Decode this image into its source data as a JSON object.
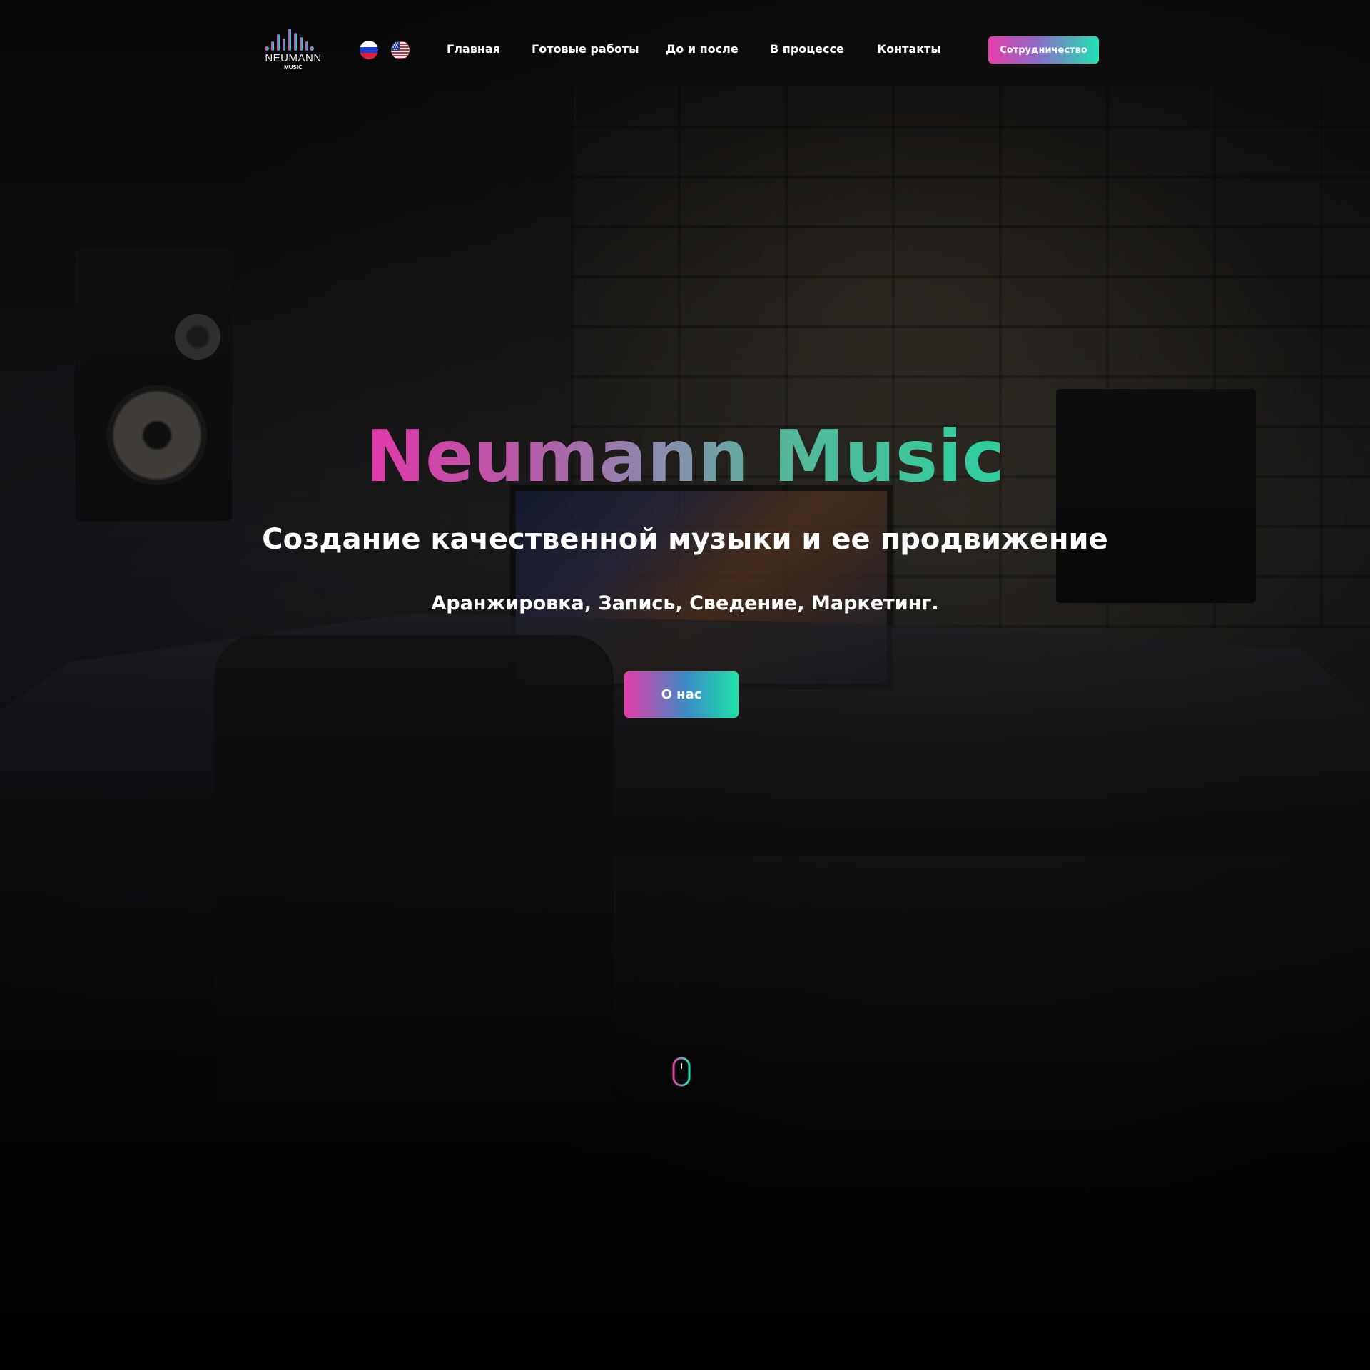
{
  "header": {
    "logo": {
      "name": "NEUMANN",
      "sub": "MUSIC"
    },
    "languages": [
      {
        "code": "ru",
        "icon": "russia-flag-icon"
      },
      {
        "code": "en",
        "icon": "usa-flag-icon"
      }
    ],
    "nav": [
      {
        "label": "Главная"
      },
      {
        "label": "Готовые работы"
      },
      {
        "label": "До и после"
      },
      {
        "label": "В процессе"
      },
      {
        "label": "Контакты"
      }
    ],
    "cta_label": "Сотрудничество"
  },
  "hero": {
    "title": "Neumann Music",
    "subtitle": "Создание качественной музыки и ее продвижение",
    "services": "Аранжировка, Запись, Сведение, Маркетинг.",
    "button_label": "О нас",
    "scroll_icon": "mouse-scroll-icon"
  },
  "colors": {
    "gradient_start": "#e63da9",
    "gradient_end": "#20e3b2",
    "background": "#0b0a0c",
    "text": "#ffffff"
  }
}
